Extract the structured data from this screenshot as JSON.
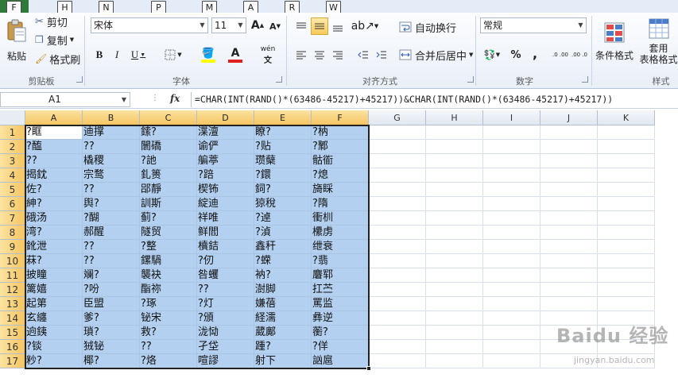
{
  "keytips": [
    "F",
    "H",
    "N",
    "P",
    "M",
    "A",
    "R",
    "W"
  ],
  "clipboard": {
    "paste": "粘贴",
    "cut": "剪切",
    "copy": "复制",
    "format_painter": "格式刷",
    "label": "剪贴板"
  },
  "font": {
    "name": "宋体",
    "size": "11",
    "label": "字体",
    "bold": "B",
    "italic": "I",
    "underline": "U",
    "font_color_letter": "A",
    "grow": "A",
    "shrink": "A",
    "wen": "wén"
  },
  "alignment": {
    "wrap_text": "自动换行",
    "merge_center": "合并后居中",
    "label": "对齐方式"
  },
  "number": {
    "format": "常规",
    "percent": "%",
    "comma": ",",
    "inc_decimal": ".0 .00",
    "dec_decimal": ".00 .0",
    "label": "数字"
  },
  "styles": {
    "conditional": "条件格式",
    "table_format_1": "套用",
    "table_format_2": "表格格式",
    "label": "样式"
  },
  "formula_bar": {
    "cell_ref": "A1",
    "fx": "fx",
    "formula": "=CHAR(INT(RAND()*(63486-45217)+45217))&CHAR(INT(RAND()*(63486-45217)+45217))"
  },
  "columns": [
    "A",
    "B",
    "C",
    "D",
    "E",
    "F",
    "G",
    "H",
    "I",
    "J",
    "K"
  ],
  "rows": [
    "1",
    "2",
    "3",
    "4",
    "5",
    "6",
    "7",
    "8",
    "9",
    "10",
    "11",
    "12",
    "13",
    "14",
    "15",
    "16",
    "17"
  ],
  "cells": [
    [
      "?眶",
      "迪撑",
      "鎍?",
      "渫澶",
      "瞭?",
      "?枘"
    ],
    [
      "?醢",
      "??",
      "闤礄",
      "谕俨",
      "?贴",
      "?鄹"
    ],
    [
      "??",
      "橇稷",
      "?訑",
      "艑葶",
      "瓒蘖",
      "骷衜"
    ],
    [
      "揭鈂",
      "宗鹜",
      "釓篑",
      "?踣",
      "?鐶",
      "?熄"
    ],
    [
      "佐?",
      "??",
      "郘靜",
      "楔钸",
      "鉰?",
      "旖睬"
    ],
    [
      "紳?",
      "舆?",
      "訓斯",
      "綻迪",
      "猄稅",
      "?隋"
    ],
    [
      "硪汤",
      "?醐",
      "蓟?",
      "祥唯",
      "?逴",
      "衝杊"
    ],
    [
      "湾?",
      "郝醒",
      "隧贸",
      "鲜閻",
      "?湞",
      "欙虏"
    ],
    [
      "鈋泄",
      "??",
      "?整",
      "櫝銡",
      "鑫秆",
      "绁衰"
    ],
    [
      "菻?",
      "??",
      "鏍騧",
      "?仞",
      "?蝾",
      "?翡"
    ],
    [
      "披瞳",
      "斓?",
      "襲袂",
      "咎蠼",
      "衲?",
      "麏郓"
    ],
    [
      "篱嬉",
      "?吩",
      "酯祢",
      "??",
      "澍脚",
      "扛苎"
    ],
    [
      "起第",
      "臣盟",
      "?琢",
      "?灯",
      "嫌蓓",
      "罵监"
    ],
    [
      "玄纏",
      "爹?",
      "铋宋",
      "?頒",
      "経濡",
      "彝逆"
    ],
    [
      "逈銕",
      "瑣?",
      "救?",
      "泷恸",
      "葳鄺",
      "蘅?"
    ],
    [
      "?锬",
      "狨铋",
      "??",
      "孑垈",
      "踵?",
      "?佯"
    ],
    [
      "粆?",
      "椰?",
      "?烙",
      "喧謬",
      "射下",
      "訩扈"
    ]
  ],
  "watermark": {
    "brand": "Baidu 经验",
    "url": "jingyan.baidu.com"
  },
  "colors": {
    "selection": "#b3d0f0",
    "header_selected": "#f5c562",
    "file_tab": "#2f7a3a"
  }
}
